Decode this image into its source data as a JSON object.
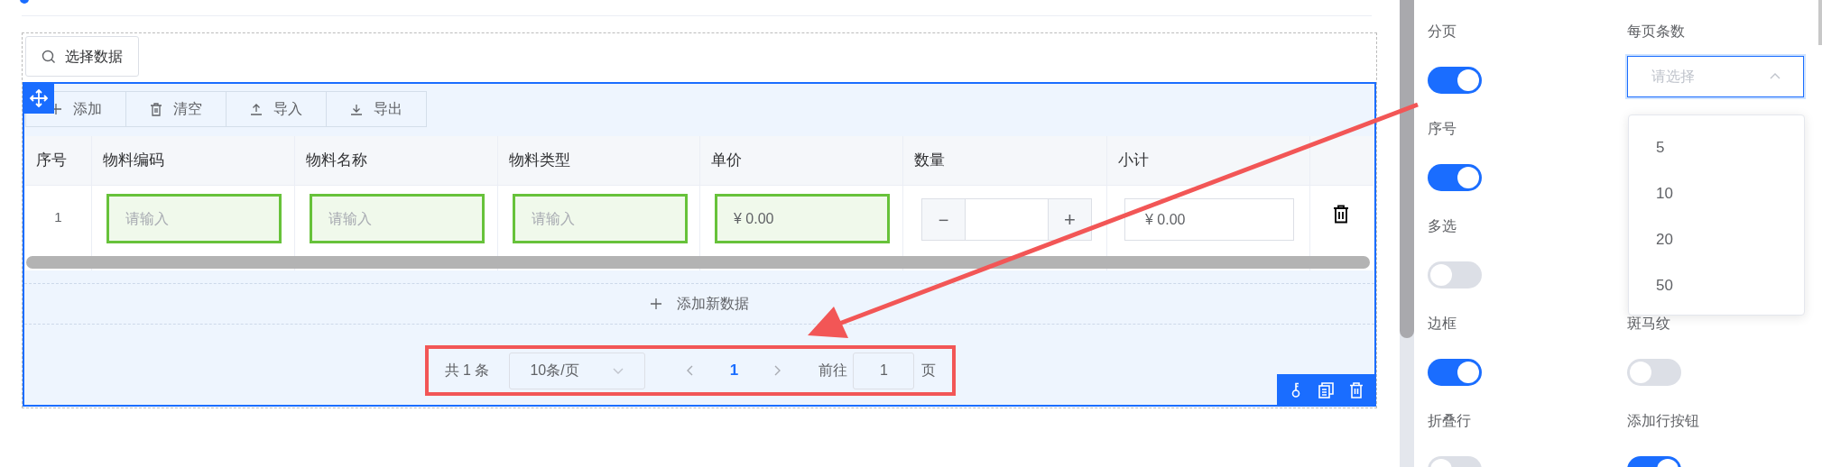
{
  "select_data_button": {
    "label": "选择数据"
  },
  "toolbar": [
    {
      "kind": "add",
      "label": "添加"
    },
    {
      "kind": "clear",
      "label": "清空"
    },
    {
      "kind": "import",
      "label": "导入"
    },
    {
      "kind": "export",
      "label": "导出"
    }
  ],
  "table": {
    "columns": [
      "序号",
      "物料编码",
      "物料名称",
      "物料类型",
      "单价",
      "数量",
      "小计"
    ],
    "rows": [
      {
        "cells": [
          {
            "kind": "index",
            "text": "1"
          },
          {
            "kind": "input",
            "placeholder": "请输入"
          },
          {
            "kind": "input",
            "placeholder": "请输入"
          },
          {
            "kind": "input",
            "placeholder": "请输入"
          },
          {
            "kind": "input",
            "value": "¥ 0.00"
          },
          {
            "kind": "stepper",
            "minus": "−",
            "plus": "+"
          },
          {
            "kind": "readonly",
            "value": "¥ 0.00"
          },
          {
            "kind": "delete"
          }
        ]
      }
    ]
  },
  "add_row": {
    "label": "添加新数据"
  },
  "pagination": {
    "total": "共 1 条",
    "page_size": "10条/页",
    "pages": [
      {
        "label": "1",
        "selected": true
      }
    ],
    "goto_label": "前往",
    "goto_value": "1",
    "page_suffix": "页"
  },
  "settings": [
    {
      "items": [
        {
          "label": "分页",
          "kind": "switch",
          "on": true
        },
        {
          "label": "每页条数",
          "kind": "select",
          "placeholder": "请选择",
          "expanded": true,
          "options": [
            "5",
            "10",
            "20",
            "50"
          ]
        }
      ]
    },
    {
      "items": [
        {
          "label": "序号",
          "kind": "switch",
          "on": true
        }
      ]
    },
    {
      "items": [
        {
          "label": "多选",
          "kind": "switch",
          "on": false
        }
      ]
    },
    {
      "items": [
        {
          "label": "边框",
          "kind": "switch",
          "on": true
        },
        {
          "label": "斑马纹",
          "kind": "switch",
          "on": false
        }
      ]
    },
    {
      "items": [
        {
          "label": "折叠行",
          "kind": "switch",
          "on": false
        },
        {
          "label": "添加行按钮",
          "kind": "switch",
          "on": true
        }
      ]
    }
  ]
}
